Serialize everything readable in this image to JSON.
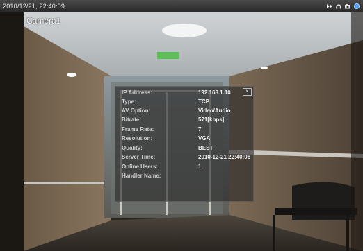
{
  "window": {
    "timestamp": "2010/12/21, 22:40:09"
  },
  "toolbar_icons": [
    "fast-forward-icon",
    "headset-icon",
    "camera-icon",
    "circle-icon"
  ],
  "camera": {
    "name": "Camera1"
  },
  "info_panel": {
    "close_label": "×",
    "rows": [
      {
        "key": "IP Address:",
        "value": "192.168.1.10"
      },
      {
        "key": "Type:",
        "value": "TCP"
      },
      {
        "key": "AV Option:",
        "value": "Video/Audio"
      },
      {
        "key": "Bitrate:",
        "value": "571[kbps]"
      },
      {
        "key": "Frame Rate:",
        "value": "7"
      },
      {
        "key": "Resolution:",
        "value": "VGA"
      },
      {
        "key": "Quality:",
        "value": "BEST"
      },
      {
        "key": "Server Time:",
        "value": "2010-12-21 22:40:08"
      },
      {
        "key": "Online Users:",
        "value": "1"
      },
      {
        "key": "Handler Name:",
        "value": ""
      }
    ]
  },
  "colors": {
    "titlebar": "#3a3a3a",
    "accent_blue": "#4aa3ff"
  }
}
